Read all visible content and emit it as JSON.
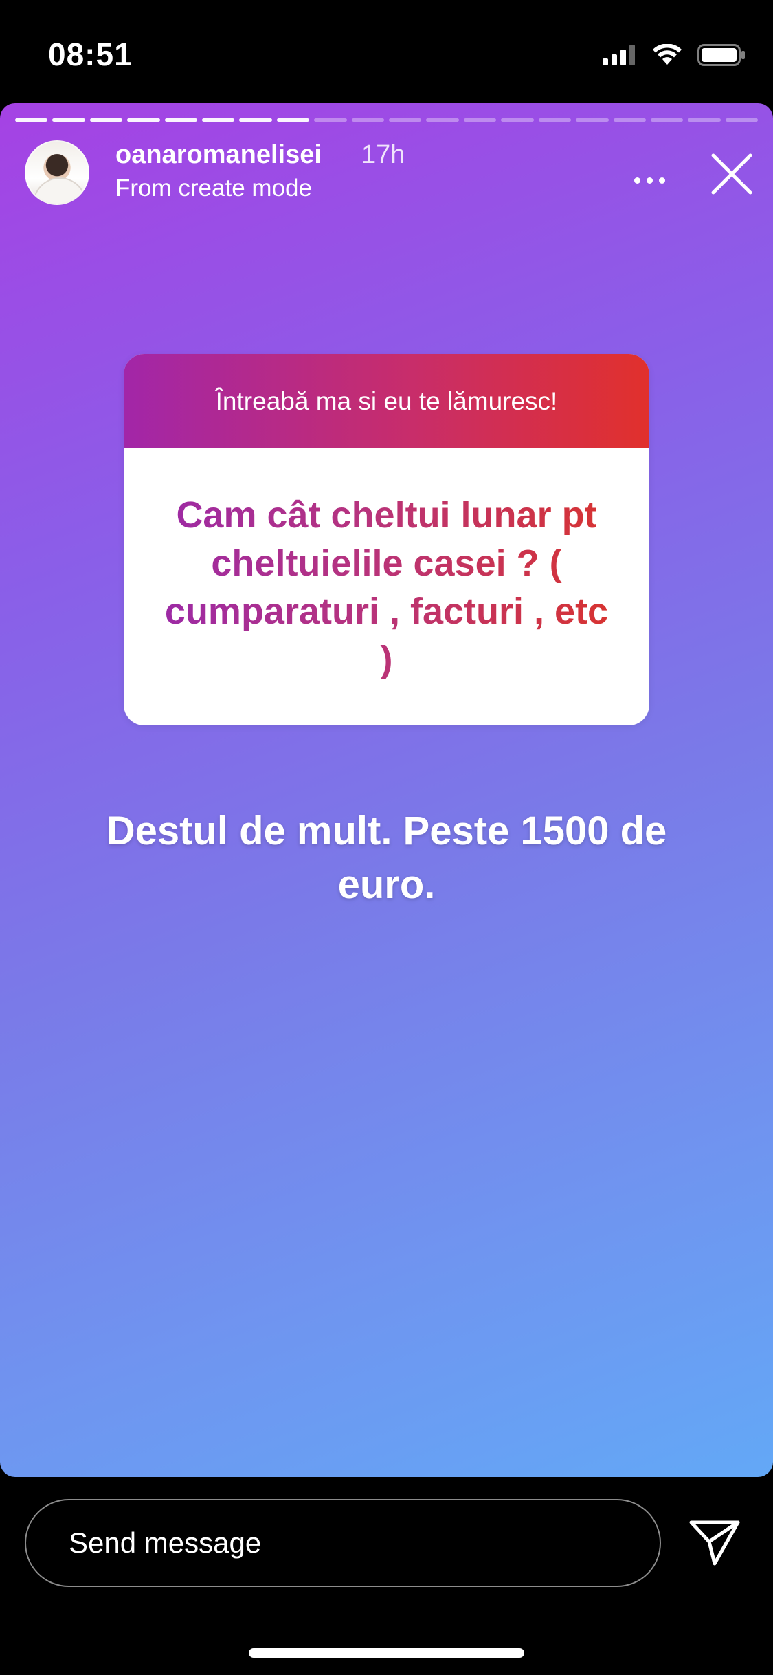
{
  "status_bar": {
    "time": "08:51"
  },
  "story": {
    "username": "oanaromanelisei",
    "time_ago": "17h",
    "subline": "From create mode",
    "progress_segments": 20,
    "progress_completed": 8,
    "question_sticker": {
      "header": "Întreabă ma si eu te lămuresc!",
      "question": "Cam cât cheltui lunar pt cheltuielile casei ? ( cumparaturi , facturi , etc )"
    },
    "answer": "Destul de mult. Peste 1500 de euro.",
    "gradient_colors": [
      "#a542e4",
      "#8a5fe8",
      "#7a7ae8",
      "#6f95f0",
      "#63a8f6"
    ]
  },
  "bottom": {
    "message_placeholder": "Send message"
  },
  "icons": {
    "more": "more-horizontal-icon",
    "close": "close-icon",
    "send": "send-paper-plane-icon",
    "signal": "cellular-signal-icon",
    "wifi": "wifi-icon",
    "battery": "battery-icon"
  }
}
